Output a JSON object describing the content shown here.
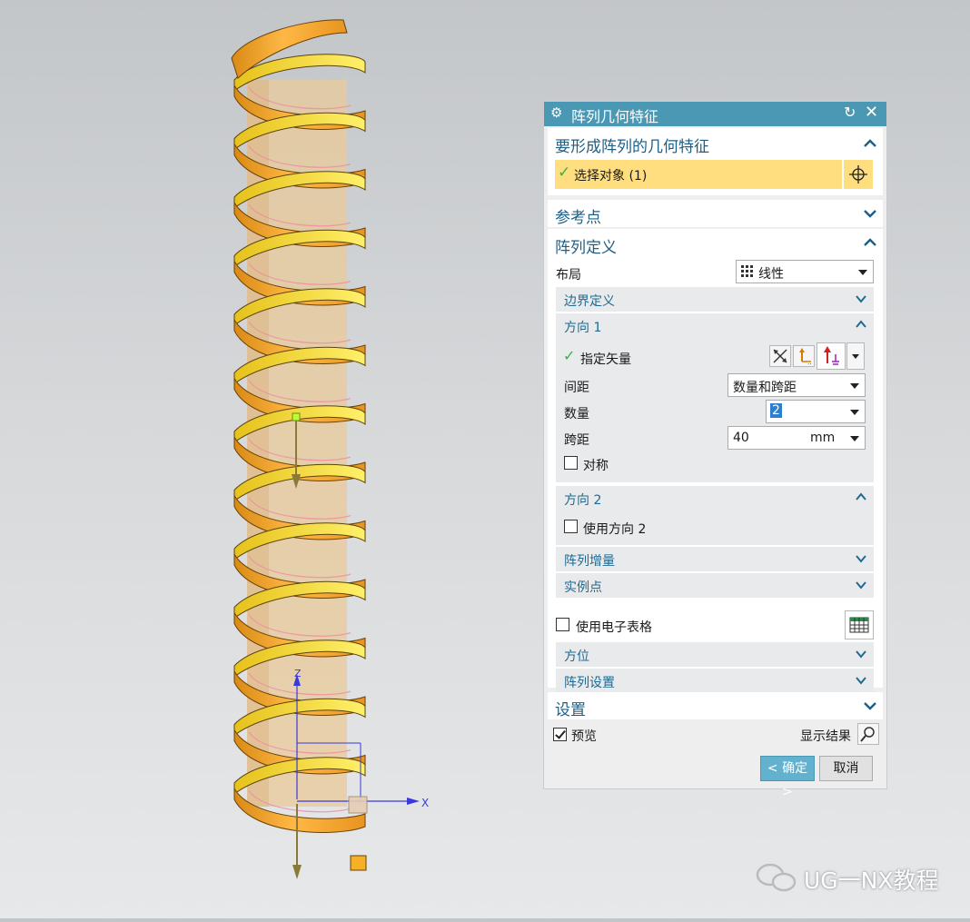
{
  "dialog": {
    "title": "阵列几何特征",
    "reset_icon": "reset-icon",
    "close_icon": "close-icon",
    "sections": {
      "geometry": {
        "title": "要形成阵列的几何特征",
        "select_object": "选择对象 (1)",
        "status_color": "#36b24a"
      },
      "reference_point": {
        "title": "参考点"
      },
      "array_definition": {
        "title": "阵列定义",
        "layout_label": "布局",
        "layout_value": "线性",
        "boundary": {
          "title": "边界定义"
        },
        "direction1": {
          "title": "方向 1",
          "specify_vector": "指定矢量",
          "spacing_label": "间距",
          "spacing_value": "数量和跨距",
          "count_label": "数量",
          "count_value": "2",
          "span_label": "跨距",
          "span_value": "40",
          "span_unit": "mm",
          "symmetric_label": "对称"
        },
        "direction2": {
          "title": "方向 2",
          "use_direction2_label": "使用方向 2"
        },
        "increment": {
          "title": "阵列增量"
        },
        "instance_point": {
          "title": "实例点"
        },
        "use_spreadsheet_label": "使用电子表格",
        "orientation": {
          "title": "方位"
        },
        "array_settings": {
          "title": "阵列设置"
        }
      },
      "settings": {
        "title": "设置"
      }
    },
    "preview_label": "预览",
    "show_result_label": "显示结果",
    "ok_label": "< 确定 >",
    "cancel_label": "取消"
  },
  "viewport": {
    "axis_x_label": "X",
    "axis_z_label": "Z",
    "colors": {
      "helix_orange": "#f5a32a",
      "helix_yellow": "#f7dc2c",
      "accent": "#4a98b4",
      "highlight": "#ffde80"
    }
  },
  "watermark": {
    "text": "UG一NX教程"
  }
}
